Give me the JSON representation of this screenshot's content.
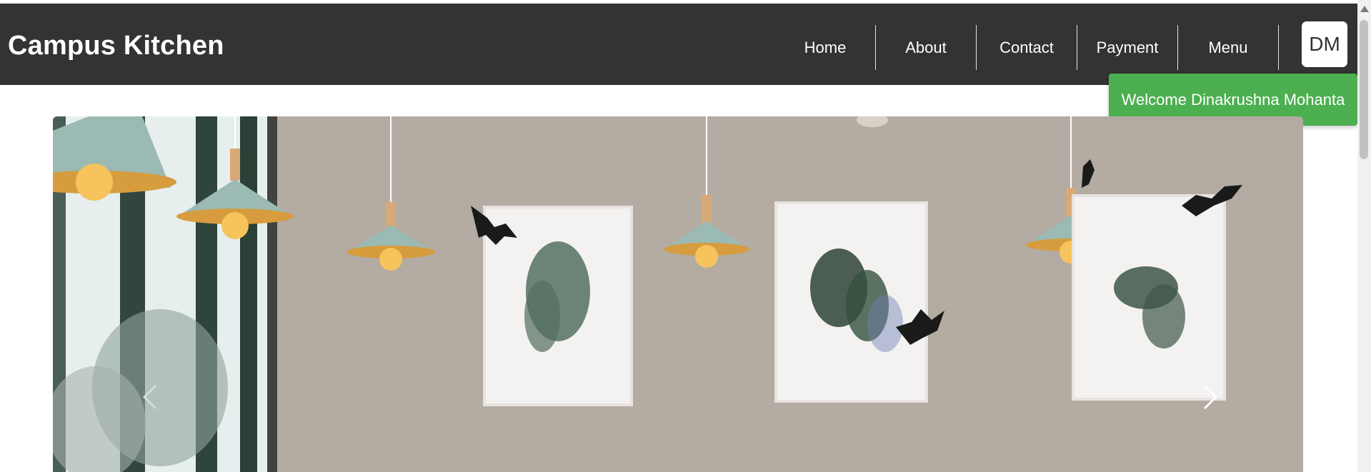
{
  "header": {
    "brand": "Campus Kitchen",
    "nav": [
      {
        "label": "Home"
      },
      {
        "label": "About"
      },
      {
        "label": "Contact"
      },
      {
        "label": "Payment"
      },
      {
        "label": "Menu"
      }
    ],
    "avatar_initials": "DM"
  },
  "welcome": {
    "message": "Welcome Dinakrushna Mohanta"
  },
  "carousel": {
    "controls": {
      "prev_icon": "chevron-left-icon",
      "next_icon": "chevron-right-icon"
    }
  },
  "colors": {
    "navbar_bg": "#333333",
    "welcome_bg": "#4caf50",
    "wall": "#b1a89f"
  }
}
